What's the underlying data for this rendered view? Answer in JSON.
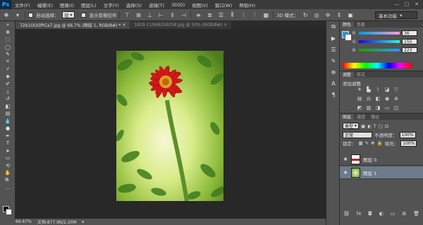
{
  "app": {
    "logo": "Ps"
  },
  "menu": [
    "文件(F)",
    "编辑(E)",
    "图像(I)",
    "图层(L)",
    "文字(Y)",
    "选择(S)",
    "滤镜(T)",
    "3D(D)",
    "视图(V)",
    "窗口(W)",
    "帮助(H)"
  ],
  "window_controls": {
    "min": "—",
    "max": "□",
    "close": "✕"
  },
  "options": {
    "auto_select_label": "自动选择：",
    "auto_select_value": "组",
    "show_transform_label": "显示变换控件",
    "mode_3d_label": "3D 模式：",
    "workspace": "基本功能"
  },
  "tabs": [
    {
      "label": "72b1OOOPICa7.jpg @ 66.7% (图层 1, RGB/8#) *",
      "close": "×"
    },
    {
      "label": "1819-110H9259258.jpg @ 50% (RGB/8#)",
      "close": "×"
    }
  ],
  "status": {
    "zoom": "66.67%",
    "doc": "文档:877.9K/2.20M"
  },
  "color_panel": {
    "tab_color": "颜色",
    "tab_swatches": "色板",
    "r_label": "R",
    "r_value": "36",
    "g_label": "G",
    "g_value": "155",
    "b_label": "B",
    "b_value": "223",
    "fg_color": "#249bdf"
  },
  "adjust_panel": {
    "tab_adjust": "调整",
    "tab_styles": "样式",
    "title": "添加调整"
  },
  "layers_panel": {
    "tab_layers": "图层",
    "tab_channels": "通道",
    "tab_paths": "路径",
    "kind": "类型",
    "blend_mode": "正常",
    "opacity_label": "不透明度：",
    "opacity_value": "100%",
    "lock_label": "锁定：",
    "fill_label": "填充：",
    "fill_value": "100%",
    "layers": [
      {
        "name": "图层 0",
        "selected": false
      },
      {
        "name": "图层 1",
        "selected": true
      }
    ]
  }
}
